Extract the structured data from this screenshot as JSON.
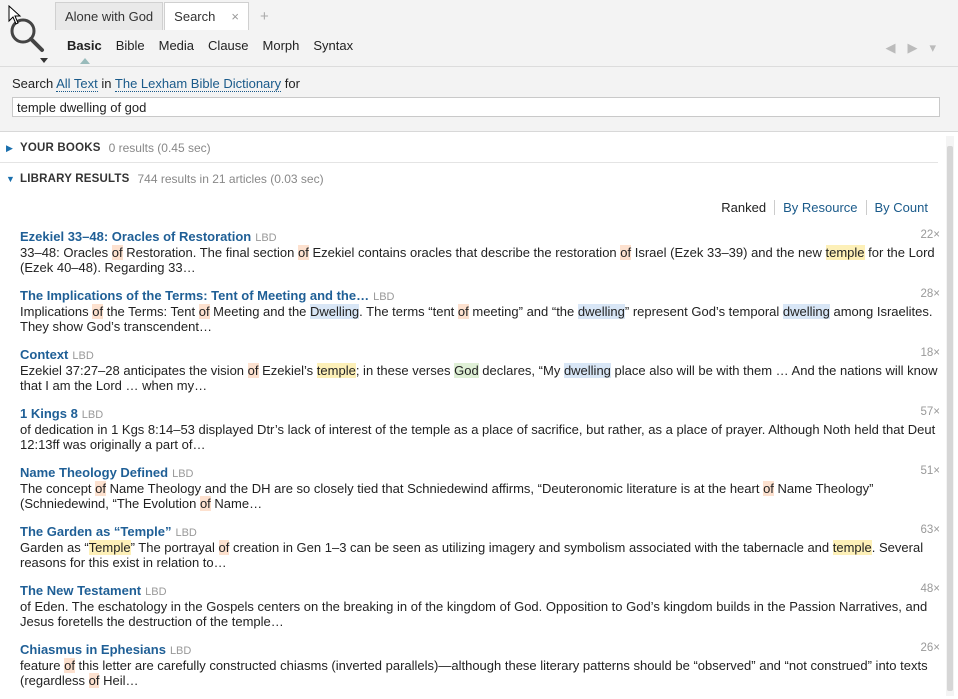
{
  "tabs": [
    {
      "label": "Alone with God"
    },
    {
      "label": "Search",
      "close": "×"
    }
  ],
  "tab_add": "+",
  "subnav": [
    "Basic",
    "Bible",
    "Media",
    "Clause",
    "Morph",
    "Syntax"
  ],
  "nav": {
    "back": "◀",
    "forward": "▶",
    "menu": "▾"
  },
  "query": {
    "prefix": "Search",
    "scope": "All Text",
    "in_word": "in",
    "resource": "The Lexham Bible Dictionary",
    "for_word": "for",
    "value": "temple dwelling of god"
  },
  "sections": {
    "your_books": {
      "label": "YOUR BOOKS",
      "meta": "0 results (0.45 sec)"
    },
    "library": {
      "label": "LIBRARY RESULTS",
      "meta": "744 results in 21 articles (0.03 sec)"
    }
  },
  "sort": {
    "ranked": "Ranked",
    "by_resource": "By Resource",
    "by_count": "By Count"
  },
  "results": [
    {
      "title": "Ezekiel 33–48: Oracles of Restoration",
      "source": "LBD",
      "count": "22×"
    },
    {
      "title": "The Implications of the Terms: Tent of Meeting and the…",
      "source": "LBD",
      "count": "28×"
    },
    {
      "title": "Context",
      "source": "LBD",
      "count": "18×"
    },
    {
      "title": "1 Kings 8",
      "source": "LBD",
      "count": "57×"
    },
    {
      "title": "Name Theology Defined",
      "source": "LBD",
      "count": "51×"
    },
    {
      "title": "The Garden as “Temple”",
      "source": "LBD",
      "count": "63×"
    },
    {
      "title": "The New Testament",
      "source": "LBD",
      "count": "48×"
    },
    {
      "title": "Chiasmus in Ephesians",
      "source": "LBD",
      "count": "26×"
    }
  ],
  "snippets": {
    "r0": [
      "33–48: Oracles ",
      "of",
      " Restoration. The final section ",
      "of",
      " Ezekiel contains oracles that describe the restoration ",
      "of",
      " Israel (Ezek 33–39) and the new ",
      "temple",
      " for the Lord (Ezek 40–48). Regarding 33…"
    ],
    "r1": [
      "Implications ",
      "of",
      " the Terms: Tent ",
      "of",
      " Meeting and the ",
      "Dwelling",
      ". The terms “tent ",
      "of",
      " meeting” and “the ",
      "dwelling",
      "” represent God’s temporal ",
      "dwelling",
      " among Israelites. They show God’s transcendent…"
    ],
    "r2": [
      "Ezekiel 37:27–28 anticipates the vision ",
      "of",
      " Ezekiel’s ",
      "temple",
      "; in these verses ",
      "God",
      " declares, “My ",
      "dwelling",
      " place also will be with them … And the nations will know that I am the Lord … when my…"
    ],
    "r3": [
      "of",
      " dedication in 1 Kgs 8:14–53 displayed Dtr’s lack ",
      "of",
      " interest ",
      "of",
      " the ",
      "temple",
      " as a place ",
      "of",
      " sacrifice, but rather, as a place ",
      "of",
      " prayer. Although Noth held that Deut 12:13ff was originally a part ",
      "of",
      "…"
    ],
    "r4": [
      "The concept ",
      "of",
      " Name Theology and the DH are so closely tied that Schniedewind affirms, “Deuteronomic literature is at the heart ",
      "of",
      " Name Theology” (Schniedewind, “The Evolution ",
      "of",
      " Name…"
    ],
    "r5": [
      "Garden as “",
      "Temple",
      "” The portrayal ",
      "of",
      " creation in Gen 1–3 can be seen as utilizing imagery and symbolism associated with the tabernacle and ",
      "temple",
      ". Several reasons for this exist in relation to…"
    ],
    "r6": [
      "of",
      " Eden. The eschatology in the Gospels centers on the breaking in ",
      "of",
      " the kingdom ",
      "of",
      " ",
      "God",
      ". Opposition to God’s kingdom builds in the Passion Narratives, and Jesus foretells the destruction ",
      "of",
      " the ",
      "temple",
      "…"
    ],
    "r7": [
      "feature ",
      "of",
      " this letter are carefully constructed chiasms (inverted parallels)—although these literary patterns should be “observed” and “not construed” into texts (regardless ",
      "of",
      " Heil…"
    ]
  },
  "colors": {
    "link": "#1f5f96",
    "hl_of": "#fde1cf",
    "hl_temple": "#fdf0b8",
    "hl_dwelling": "#d8e6f6",
    "hl_god": "#dff0d6"
  }
}
